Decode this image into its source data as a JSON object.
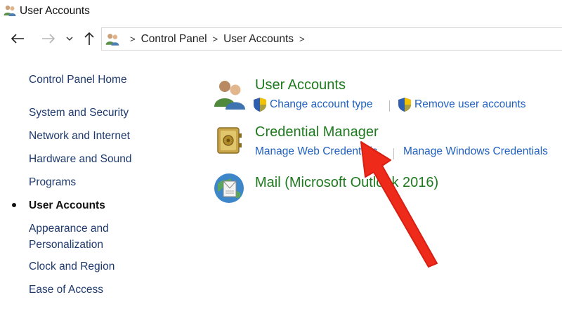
{
  "window": {
    "title": "User Accounts"
  },
  "nav": {
    "back_icon": "arrow-left-icon",
    "forward_icon": "arrow-right-icon",
    "recent_icon": "chevron-down-icon",
    "up_icon": "arrow-up-icon"
  },
  "address": {
    "separator": ">",
    "crumbs": [
      "Control Panel",
      "User Accounts"
    ]
  },
  "sidebar": {
    "items": [
      {
        "label": "Control Panel Home"
      },
      {
        "label": "System and Security"
      },
      {
        "label": "Network and Internet"
      },
      {
        "label": "Hardware and Sound"
      },
      {
        "label": "Programs"
      },
      {
        "label": "User Accounts",
        "active": true
      },
      {
        "label": "Appearance and Personalization",
        "line1": "Appearance and",
        "line2": "Personalization"
      },
      {
        "label": "Clock and Region"
      },
      {
        "label": "Ease of Access"
      }
    ]
  },
  "categories": {
    "user_accounts": {
      "title": "User Accounts",
      "icon": "users-icon",
      "links": [
        "Change account type",
        "Remove user accounts"
      ]
    },
    "credential_manager": {
      "title": "Credential Manager",
      "icon": "vault-icon",
      "links": [
        "Manage Web Credentials",
        "Manage Windows Credentials"
      ]
    },
    "mail": {
      "title": "Mail (Microsoft Outlook 2016)",
      "icon": "mail-globe-icon"
    }
  },
  "colors": {
    "category_title": "#1e7a1e",
    "link": "#1f5fbf",
    "sidebar_link": "#1e3a6e",
    "annotation_arrow": "#ee2a1b"
  }
}
